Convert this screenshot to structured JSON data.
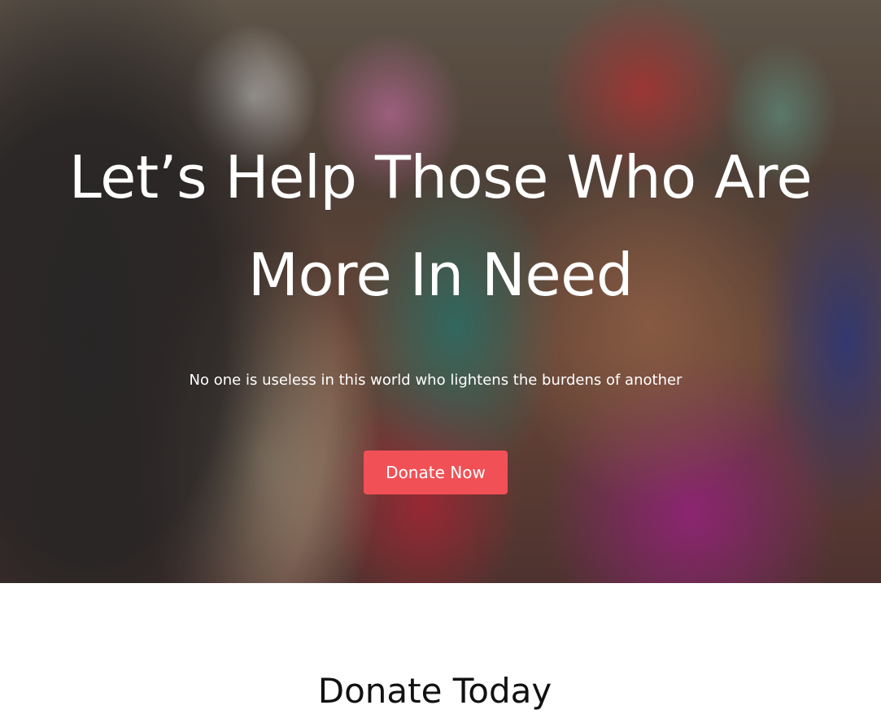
{
  "hero": {
    "title_line1": "Let’s Help Those Who Are",
    "title_line2": "More In Need",
    "subtitle": "No one is useless in this world who lightens the burdens of another",
    "cta_label": "Donate Now"
  },
  "donate_section": {
    "title": "Donate Today"
  },
  "colors": {
    "accent": "#f15156",
    "text_light": "#ffffff",
    "text_dark": "#111111"
  }
}
